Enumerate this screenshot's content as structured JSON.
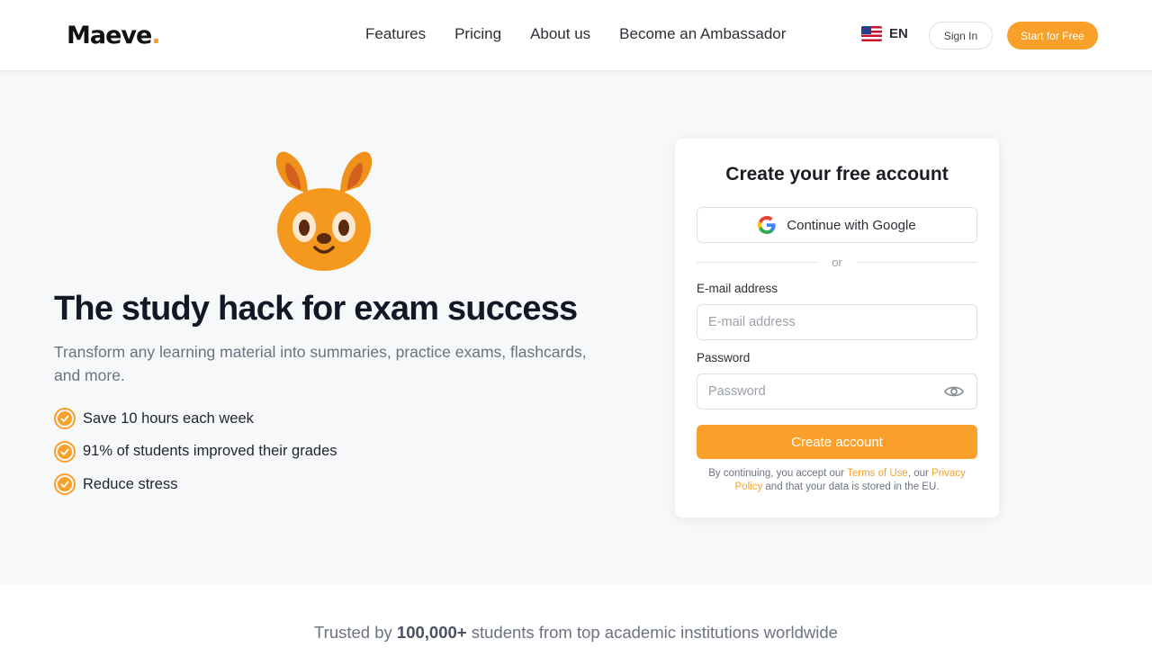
{
  "header": {
    "logo_text": "Maeve",
    "logo_dot": ".",
    "nav": [
      "Features",
      "Pricing",
      "About us",
      "Become an Ambassador"
    ],
    "language": "EN",
    "sign_in": "Sign In",
    "start_free": "Start for Free"
  },
  "hero": {
    "headline": "The study hack for exam success",
    "subtext": "Transform any learning material into summaries, practice exams, flashcards, and more.",
    "bullets": [
      "Save 10 hours each week",
      "91% of students improved their grades",
      "Reduce stress"
    ]
  },
  "signup": {
    "title": "Create your free account",
    "google_label": "Continue with Google",
    "divider": "or",
    "email_label": "E-mail address",
    "email_placeholder": "E-mail address",
    "password_label": "Password",
    "password_placeholder": "Password",
    "submit": "Create account",
    "terms_prefix": "By continuing, you accept our ",
    "terms_link": "Terms of Use",
    "terms_mid": ", our ",
    "privacy_link": "Privacy Policy",
    "terms_suffix": " and that your data is stored in the EU."
  },
  "trusted": {
    "prefix": "Trusted by ",
    "count": "100,000+",
    "suffix": " students from top academic institutions worldwide"
  },
  "colors": {
    "accent": "#f9a02a",
    "hero_bg": "#f7f8fa",
    "headline": "#121826"
  },
  "icons": {
    "flag": "us-flag-icon",
    "google": "google-g-icon",
    "eye": "eye-icon",
    "check": "check-circle-icon",
    "mascot": "squirrel-mascot"
  }
}
